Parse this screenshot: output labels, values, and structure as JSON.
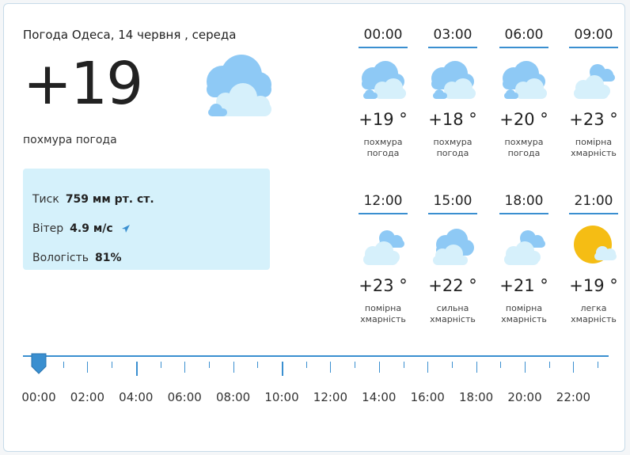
{
  "current": {
    "title": "Погода Одеса, 14 червня , середа",
    "temperature": "+19",
    "condition": "похмура погода",
    "icon": "cloudy-icon",
    "details": {
      "pressure_label": "Тиск",
      "pressure_value": "759 мм рт. ст.",
      "wind_label": "Вітер",
      "wind_value": "4.9 м/с",
      "humidity_label": "Вологість",
      "humidity_value": "81%"
    }
  },
  "hourly": [
    {
      "time": "00:00",
      "temp": "+19 °",
      "condition": "похмура погода",
      "icon": "overcast-icon"
    },
    {
      "time": "03:00",
      "temp": "+18 °",
      "condition": "похмура погода",
      "icon": "overcast-icon"
    },
    {
      "time": "06:00",
      "temp": "+20 °",
      "condition": "похмура погода",
      "icon": "overcast-icon"
    },
    {
      "time": "09:00",
      "temp": "+23 °",
      "condition": "помірна хмарність",
      "icon": "partly-cloudy-icon"
    },
    {
      "time": "12:00",
      "temp": "+23 °",
      "condition": "помірна хмарність",
      "icon": "partly-cloudy-icon"
    },
    {
      "time": "15:00",
      "temp": "+22 °",
      "condition": "сильна хмарність",
      "icon": "cloudy-icon"
    },
    {
      "time": "18:00",
      "temp": "+21 °",
      "condition": "помірна хмарність",
      "icon": "partly-cloudy-icon"
    },
    {
      "time": "21:00",
      "temp": "+19 °",
      "condition": "легка хмарність",
      "icon": "sun-cloud-icon"
    }
  ],
  "timeline": {
    "labels": [
      "00:00",
      "02:00",
      "04:00",
      "06:00",
      "08:00",
      "10:00",
      "12:00",
      "14:00",
      "16:00",
      "18:00",
      "20:00",
      "22:00"
    ],
    "selected": "00:00"
  },
  "colors": {
    "accent": "#3a8fd0",
    "details_bg": "#d5f1fb",
    "cloud_dark": "#8ec9f5",
    "cloud_light": "#d6f0fb",
    "sun": "#f5bd14"
  }
}
